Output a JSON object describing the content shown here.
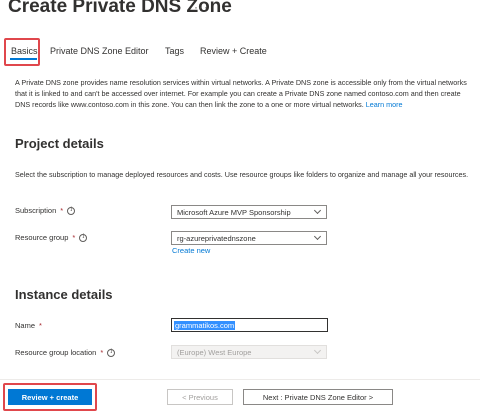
{
  "header": {
    "title": "Create Private DNS Zone",
    "more": "···"
  },
  "tabs": [
    {
      "label": "Basics"
    },
    {
      "label": "Private DNS Zone Editor"
    },
    {
      "label": "Tags"
    },
    {
      "label": "Review + Create"
    }
  ],
  "intro": {
    "text": "A Private DNS zone provides name resolution services within virtual networks. A Private DNS zone is accessible only from the virtual networks that it is linked to and can't be accessed over internet. For example you can create a Private DNS zone named contoso.com and then create DNS records like www.contoso.com in this zone. You can then link the zone to a one or more virtual networks.",
    "link": "Learn more"
  },
  "project": {
    "heading": "Project details",
    "description": "Select the subscription to manage deployed resources and costs. Use resource groups like folders to organize and manage all your resources.",
    "subscription_label": "Subscription",
    "subscription_value": "Microsoft Azure MVP Sponsorship",
    "resource_group_label": "Resource group",
    "resource_group_value": "rg-azureprivatednszone",
    "create_new": "Create new"
  },
  "instance": {
    "heading": "Instance details",
    "name_label": "Name",
    "name_value": "grammatikos.com",
    "location_label": "Resource group location",
    "location_value": "(Europe) West Europe"
  },
  "required_marker": "*",
  "footer": {
    "review_create": "Review + create",
    "previous": "< Previous",
    "next": "Next : Private DNS Zone Editor >"
  },
  "colors": {
    "accent": "#0078d4",
    "highlight": "#e0474c"
  }
}
